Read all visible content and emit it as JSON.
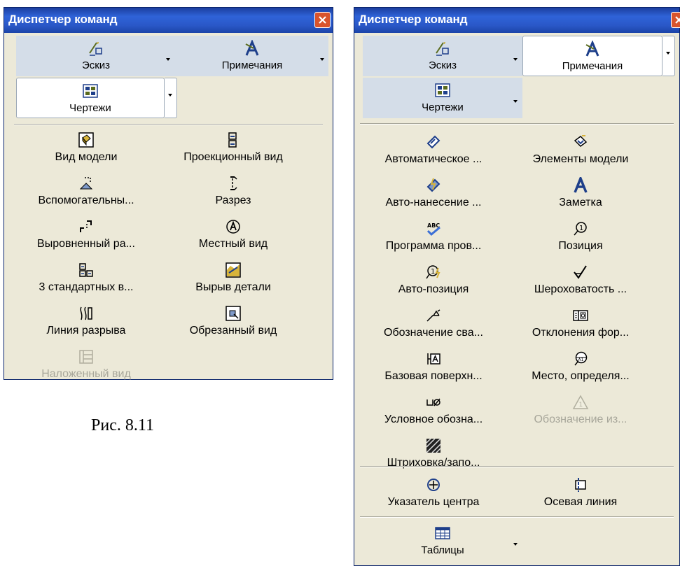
{
  "left_panel": {
    "title": "Диспетчер команд",
    "tabs": [
      {
        "label": "Эскиз",
        "icon": "sketch-icon"
      },
      {
        "label": "Примечания",
        "icon": "annotation-icon"
      },
      {
        "label": "Чертежи",
        "icon": "drawings-icon"
      }
    ],
    "commands": [
      {
        "label": "Вид модели",
        "icon": "model-view-icon",
        "enabled": true
      },
      {
        "label": "Проекционный вид",
        "icon": "projected-view-icon",
        "enabled": true
      },
      {
        "label": "Вспомогательны...",
        "icon": "auxiliary-view-icon",
        "enabled": true
      },
      {
        "label": "Разрез",
        "icon": "section-view-icon",
        "enabled": true
      },
      {
        "label": "Выровненный ра...",
        "icon": "aligned-section-icon",
        "enabled": true
      },
      {
        "label": "Местный вид",
        "icon": "detail-view-icon",
        "enabled": true
      },
      {
        "label": "3 стандартных в...",
        "icon": "standard-views-icon",
        "enabled": true
      },
      {
        "label": "Вырыв детали",
        "icon": "broken-out-section-icon",
        "enabled": true
      },
      {
        "label": "Линия разрыва",
        "icon": "break-line-icon",
        "enabled": true
      },
      {
        "label": "Обрезанный вид",
        "icon": "crop-view-icon",
        "enabled": true
      },
      {
        "label": "Наложенный вид",
        "icon": "alternate-position-view-icon",
        "enabled": false
      }
    ]
  },
  "caption": "Рис. 8.11",
  "right_panel": {
    "title": "Диспетчер команд",
    "tabs": [
      {
        "label": "Эскиз",
        "icon": "sketch-icon"
      },
      {
        "label": "Примечания",
        "icon": "annotation-icon"
      },
      {
        "label": "Чертежи",
        "icon": "drawings-icon"
      }
    ],
    "commands": [
      {
        "label": "Автоматическое ...",
        "icon": "smart-dimension-icon",
        "enabled": true
      },
      {
        "label": "Элементы модели",
        "icon": "model-items-icon",
        "enabled": true
      },
      {
        "label": "Авто-нанесение ...",
        "icon": "auto-dimension-icon",
        "enabled": true
      },
      {
        "label": "Заметка",
        "icon": "note-icon",
        "enabled": true
      },
      {
        "label": "Программа пров...",
        "icon": "spell-check-icon",
        "enabled": true
      },
      {
        "label": "Позиция",
        "icon": "balloon-icon",
        "enabled": true
      },
      {
        "label": "Авто-позиция",
        "icon": "auto-balloon-icon",
        "enabled": true
      },
      {
        "label": "Шероховатость ...",
        "icon": "surface-finish-icon",
        "enabled": true
      },
      {
        "label": "Обозначение сва...",
        "icon": "weld-symbol-icon",
        "enabled": true
      },
      {
        "label": "Отклонения фор...",
        "icon": "geometric-tolerance-icon",
        "enabled": true
      },
      {
        "label": "Базовая поверхн...",
        "icon": "datum-feature-icon",
        "enabled": true
      },
      {
        "label": "Место, определя...",
        "icon": "datum-target-icon",
        "enabled": true
      },
      {
        "label": "Условное обозна...",
        "icon": "hole-callout-icon",
        "enabled": true
      },
      {
        "label": "Обозначение из...",
        "icon": "revision-symbol-icon",
        "enabled": false
      },
      {
        "label": "Штриховка/запо...",
        "icon": "area-hatch-icon",
        "enabled": true
      }
    ],
    "commands2": [
      {
        "label": "Указатель центра",
        "icon": "center-mark-icon",
        "enabled": true
      },
      {
        "label": "Осевая линия",
        "icon": "centerline-icon",
        "enabled": true
      }
    ],
    "tables": {
      "label": "Таблицы",
      "icon": "table-icon"
    }
  },
  "colors": {
    "titlebar": "#2a58c8",
    "panel": "#ece9d8",
    "close": "#d9542c",
    "disabled_text": "#a7a69a"
  }
}
